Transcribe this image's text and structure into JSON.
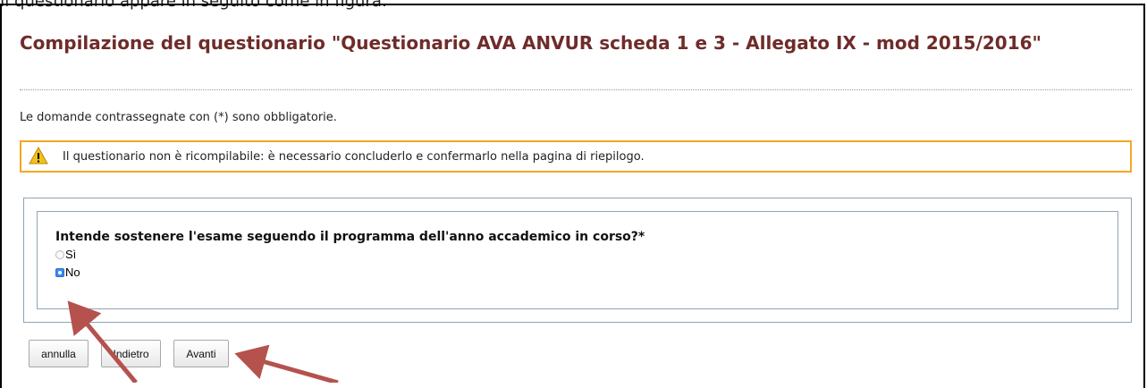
{
  "page": {
    "top_caption": "Il questionario appare in seguito come in figura:",
    "title": "Compilazione del questionario \"Questionario AVA ANVUR scheda 1 e 3 - Allegato IX - mod 2015/2016\"",
    "required_note": "Le domande contrassegnate con (*) sono obbligatorie."
  },
  "warning": {
    "icon": "warning-triangle-icon",
    "text": "Il questionario non è ricompilabile: è necessario concluderlo e confermarlo nella pagina di riepilogo.",
    "border_color": "#f5a623"
  },
  "question": {
    "text": "Intende sostenere l'esame seguendo il programma dell'anno accademico in corso?*",
    "options": [
      {
        "label": "Sì",
        "selected": false
      },
      {
        "label": "No",
        "selected": true
      }
    ]
  },
  "buttons": {
    "cancel_label": "annulla",
    "back_label": "Indietro",
    "next_label": "Avanti"
  },
  "annotations": {
    "arrow_color": "#b5524d",
    "arrows": [
      "arrow-to-no-option",
      "arrow-to-avanti-button"
    ]
  },
  "colors": {
    "title": "#6e2c2a",
    "question_border": "#90a4b4"
  }
}
